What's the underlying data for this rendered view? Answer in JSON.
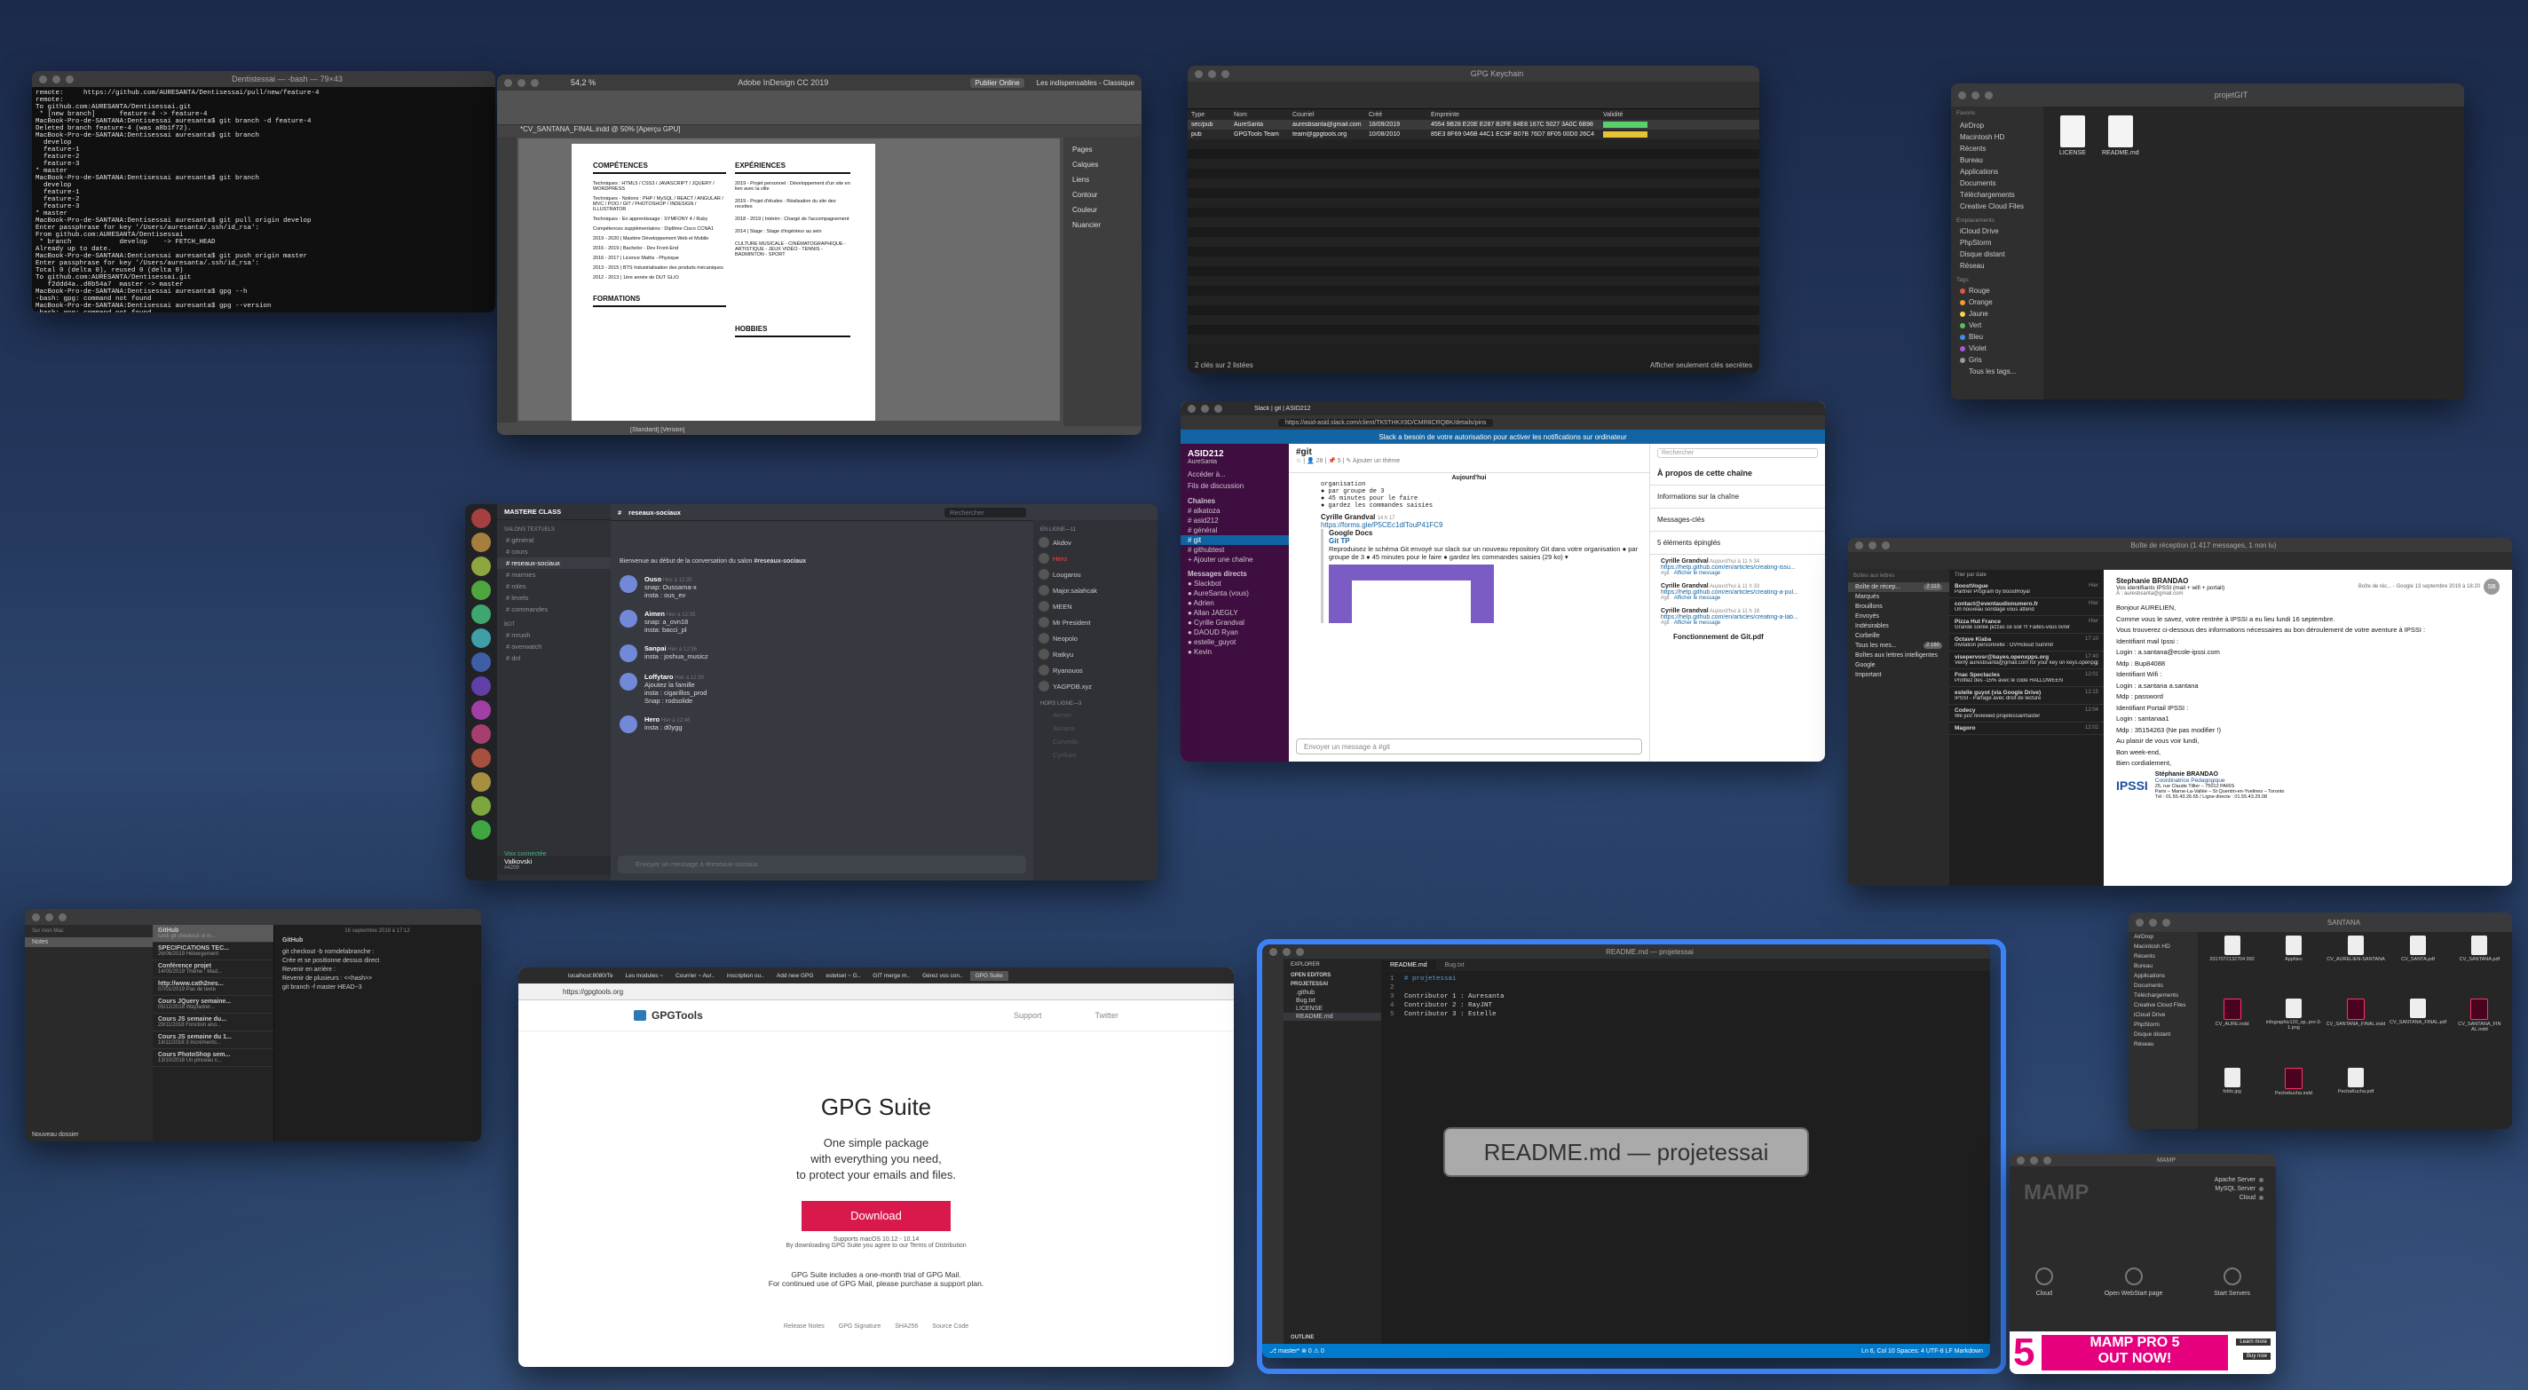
{
  "terminal": {
    "title": "Dentistessai — -bash — 79×43",
    "lines": [
      "remote:     https://github.com/AURESANTA/Dentisessai/pull/new/feature-4",
      "remote:",
      "To github.com:AURESANTA/Dentisessai.git",
      " * [new branch]      feature-4 -> feature-4",
      "MacBook-Pro-de-SANTANA:Dentisessai auresanta$ git branch -d feature-4",
      "Deleted branch feature-4 (was a8b1f72).",
      "MacBook-Pro-de-SANTANA:Dentisessai auresanta$ git branch",
      "  develop",
      "  feature-1",
      "  feature-2",
      "  feature-3",
      "* master",
      "MacBook-Pro-de-SANTANA:Dentisessai auresanta$ git branch",
      "  develop",
      "  feature-1",
      "  feature-2",
      "  feature-3",
      "* master",
      "MacBook-Pro-de-SANTANA:Dentisessai auresanta$ git pull origin develop",
      "Enter passphrase for key '/Users/auresanta/.ssh/id_rsa':",
      "From github.com:AURESANTA/Dentisessai",
      " * branch            develop    -> FETCH_HEAD",
      "Already up to date.",
      "MacBook-Pro-de-SANTANA:Dentisessai auresanta$ git push origin master",
      "Enter passphrase for key '/Users/auresanta/.ssh/id_rsa':",
      "Total 0 (delta 0), reused 0 (delta 0)",
      "To github.com:AURESANTA/Dentisessai.git",
      "   f2ddd4a..d8b54a7  master -> master",
      "MacBook-Pro-de-SANTANA:Dentisessai auresanta$ gpg --h",
      "-bash: gpg: command not found",
      "MacBook-Pro-de-SANTANA:Dentisessai auresanta$ gpg --version",
      "-bash: gpg: command not found",
      "MacBook-Pro-de-SANTANA:Dentisessai auresanta$ "
    ]
  },
  "indesign": {
    "title": "Adobe InDesign CC 2019",
    "publish_btn": "Publier Online",
    "workspace": "Les indispensables - Classique",
    "zoom": "54,2 %",
    "doc_tab": "*CV_SANTANA_FINAL.indd @ 50% [Aperçu GPU]",
    "status": "[Standard] [Version]",
    "panels": [
      "Pages",
      "Calques",
      "Liens",
      "Contour",
      "Couleur",
      "Nuancier"
    ],
    "resume": {
      "competences_h": "COMPÉTENCES",
      "experiences_h": "EXPÉRIENCES",
      "formations_h": "FORMATIONS",
      "hobbies_h": "HOBBIES",
      "left": [
        "Techniques : HTML5 / CSS3 / JAVASCRIPT / JQUERY / WORDPRESS",
        "Techniques - Notions : PHP / MySQL / REACT / ANGULAR / MVC / POO / GIT / PHOTOSHOP / INDESIGN / ILLUSTRATOR",
        "Techniques - En apprentissage : SYMFONY 4 / Ruby",
        "Compétences supplémentaires : Diplôme Cisco CCNA1",
        "2019 - 2020 | Mastère Développement Web et Mobile",
        "2016 - 2019 | Bachelor - Dev Front-End",
        "2016 - 2017 | Licence Maths - Physique",
        "2013 - 2015 | BTS Industrialisation des produits mécaniques",
        "2012 - 2013 | 1ère année de DUT GLIO"
      ],
      "right": [
        "2019 - Projet personnel : Développement d'un site en lien avec la ville",
        "2019 - Projet d'études : Réalisation du site des recettes",
        "2018 - 2019 | Intérim : Chargé de l'accompagnement",
        "2014 | Stage : Stage d'ingénieur au sein",
        "CULTURE MUSICALE - CINÉMATOGRAPHIQUE - ARTISTIQUE - JEUX VIDÉO - TENNIS - BADMINTON - SPORT"
      ]
    }
  },
  "gpg_keychain": {
    "title": "GPG Keychain",
    "headers": [
      "Type",
      "Nom",
      "Courriel",
      "Créé",
      "Empreinte",
      "Validité"
    ],
    "rows": [
      {
        "type": "sec/pub",
        "name": "AureSanta",
        "email": "auresbsanta@gmail.com",
        "created": "18/09/2019",
        "fpr": "4554 9B28 E20E E287 B2FE  84E8 167C 5027 3A0C 6B98",
        "validity": "#5ad06a"
      },
      {
        "type": "pub",
        "name": "GPGTools Team",
        "email": "team@gpgtools.org",
        "created": "10/08/2010",
        "fpr": "85E3 8F69 046B 44C1 EC9F  B07B 76D7 8F05 00D0 26C4",
        "validity": "#e6c332"
      }
    ],
    "status": "2 clés sur 2 listées",
    "show_secret": "Afficher seulement clés secrètes"
  },
  "finder_top": {
    "title": "projetGIT",
    "sections": {
      "favoris": "Favoris",
      "emplacements": "Emplacements",
      "tags": "Tags"
    },
    "favoris": [
      "AirDrop",
      "Macintosh HD",
      "Récents",
      "Bureau",
      "Applications",
      "Documents",
      "Téléchargements",
      "Creative Cloud Files"
    ],
    "emplacements": [
      "iCloud Drive",
      "PhpStorm",
      "Disque distant",
      "Réseau"
    ],
    "tags": [
      "Rouge",
      "Orange",
      "Jaune",
      "Vert",
      "Bleu",
      "Violet",
      "Gris",
      "Tous les tags..."
    ],
    "tag_colors": [
      "#e5534b",
      "#f09a37",
      "#f5d547",
      "#5ac05a",
      "#3f8de8",
      "#a45cd6",
      "#9a9a9a",
      "#00000000"
    ],
    "files": [
      "LICENSE",
      "README.md"
    ]
  },
  "slack": {
    "browser_tab": "Slack | git | ASID212",
    "url": "https://asid-asid.slack.com/client/TK5THKX9D/CMR8CRQBK/details/pins",
    "banner": "Slack a besoin de votre autorisation pour activer les notifications sur ordinateur",
    "banner_link": "activer les notifications sur ordinateur",
    "workspace": "ASID212",
    "user": "AureSanta",
    "nav": [
      "Accéder à...",
      "Fils de discussion"
    ],
    "channels_h": "Chaînes",
    "channels": [
      "alkatoza",
      "asid212",
      "général",
      "git",
      "githubtest"
    ],
    "add_channel": "+ Ajouter une chaîne",
    "dm_h": "Messages directs",
    "dms": [
      "Slackbot",
      "AureSanta (vous)",
      "Adrien",
      "Allan JAEGLY",
      "Cyrille Grandval",
      "DAOUD Ryan",
      "estelle_guyot",
      "Kevin"
    ],
    "channel": "#git",
    "channel_meta": "☆ | 👤 28 | 📌 5 | ✎ Ajouter un thème",
    "search_ph": "Rechercher",
    "today": "Aujourd'hui",
    "msg_pre": [
      "organisation",
      "● par groupe de 3",
      "● 45 minutes pour le faire",
      "● gardez les commandes saisies"
    ],
    "author": "Cyrille Grandval",
    "time": "14 h 17",
    "link": "https://forms.gle/P5CEc1dITouP41FC9",
    "gdoc": "Google Docs",
    "gtitle": "Git TP",
    "body": "Reproduisez le schéma Git envoyé sur slack sur un nouveau repository Git dans votre organisation ● par groupe de 3 ● 45 minutes pour le faire ● gardez les commandes saisies (29 ko) ▾",
    "composer": "Envoyer un message à #git",
    "details_title": "À propos de cette chaîne",
    "details": [
      "Informations sur la chaîne",
      "Messages-clés",
      "5 éléments épinglés"
    ],
    "pins": [
      {
        "who": "Cyrille Grandval",
        "when": "Aujourd'hui à 11 h 34",
        "link": "https://help.github.com/en/articles/creating-issu..."
      },
      {
        "who": "Cyrille Grandval",
        "when": "Aujourd'hui à 11 h 33",
        "link": "https://help.github.com/en/articles/creating-a-pul..."
      },
      {
        "who": "Cyrille Grandval",
        "when": "Aujourd'hui à 11 h 18",
        "link": "https://help.github.com/en/articles/creating-a-lab..."
      }
    ],
    "pin_channel": "#git",
    "pin_action": "Afficher le message",
    "pdf": "Fonctionnement de Git.pdf"
  },
  "discord": {
    "server": "MASTERE CLASS",
    "channel": "reseaux-sociaux",
    "search_ph": "Rechercher",
    "category1": "SALONS TEXTUELS",
    "channels": [
      "général",
      "cours",
      "reseaux-sociaux",
      "marmes",
      "roles",
      "levels",
      "commandes"
    ],
    "category2": "BOT",
    "channels2": [
      "mruoh",
      "overwatch",
      "dnl"
    ],
    "welcome": "Bienvenue au début de la conversation du salon ",
    "welcome_bold": "#reseaux-sociaux",
    "messages": [
      {
        "name": "Ouso",
        "time": "Hier à 12:35",
        "lines": [
          "snap: Oussama-x",
          "insta : ous_ev"
        ]
      },
      {
        "name": "Aimen",
        "time": "Hier à 12:35",
        "lines": [
          "snap: a_ovn18",
          "insta: bacci_pl"
        ]
      },
      {
        "name": "Sanpai",
        "time": "Hier à 12:36",
        "lines": [
          "insta : joshua_musicz"
        ]
      },
      {
        "name": "Loffytaro",
        "time": "Hier à 12:39",
        "lines": [
          "Ajoutez la famille",
          "insta : cigarillos_prod",
          "Snap : rodsolide"
        ]
      },
      {
        "name": "Hero",
        "time": "Hier à 12:46",
        "lines": [
          "insta : d0ygg"
        ]
      }
    ],
    "composer": "Envoyer un message à #reseaux-sociaux",
    "members_h": "EN LIGNE—11",
    "members": [
      "Akdov",
      "Hero",
      "Lougarou",
      "Major.salahcak",
      "MEEN",
      "Mr President",
      "Neopolo",
      "Ratkyu",
      "Ryanouos",
      "YAGPDB.xyz"
    ],
    "offline_h": "HORS LIGNE—3",
    "offline": [
      "Aiman",
      "Aksana",
      "Curvedo",
      "Cyriluxe"
    ],
    "connected": "Voix connectée",
    "user": "Valkovski",
    "user_tag": "#4209"
  },
  "mail": {
    "title": "Boîte de réception (1 417 messages, 1 non lu)",
    "filter": "Trier par date",
    "mailboxes_h": "Boîtes aux lettres",
    "mailboxes": [
      "Boîte de récep...",
      "Marqués",
      "Brouillons",
      "Envoyés",
      "Indésirables",
      "Corbeille",
      "Tous les mes...",
      "Boîtes aux lettres intelligentes",
      "Google",
      "Important"
    ],
    "mailbox_counts": [
      "2 113",
      "",
      "",
      "",
      "",
      "",
      "2 160",
      "",
      "",
      ""
    ],
    "list": [
      {
        "from": "BoostVogue",
        "subj": "Partner Program by BoostRoyal",
        "when": "Hier"
      },
      {
        "from": "contact@eventaudionumero.fr",
        "subj": "Un nouveau sondage vous attend",
        "when": "Hier"
      },
      {
        "from": "Pizza Hut France",
        "subj": "Grande soirée pizzas ce soir !!! Faites-vous livrer",
        "when": "Hier"
      },
      {
        "from": "Octave Klaba",
        "subj": "Invitation personnelle : OVHcloud Summit",
        "when": "17:10"
      },
      {
        "from": "visepervosr@bayes.openxpps.org",
        "subj": "Verify auresbsanta@gmail.com for your key on keys.openpgp.org",
        "when": "17:40"
      },
      {
        "from": "Fnac Spectacles",
        "subj": "Profitez des -15% avec le code HALLOWEEN",
        "when": "12:01"
      },
      {
        "from": "estelle guyot (via Google Drive)",
        "subj": "IPSSI - Partage avec droit de lecture",
        "when": "12:15"
      },
      {
        "from": "Codecy",
        "subj": "We just reviewed projetessai/master",
        "when": "12:04"
      },
      {
        "from": "Magoro",
        "subj": "",
        "when": "12:02"
      }
    ],
    "from": "Stephanie BRANDAO",
    "to": "Vos identifiants IPSSI (mail + wifi + portail)",
    "to2": "À : auresbsanta@gmail.com",
    "date": "Boîte de réc... - Google   13 septembre 2019 à 18:20",
    "avatar": "SB",
    "body": [
      "Bonjour AURELIEN,",
      "Comme vous le savez, votre rentrée à IPSSI a eu lieu lundi 16 septembre.",
      "Vous trouverez ci-dessous des informations nécessaires au bon déroulement de votre aventure à IPSSI :",
      "Identifiant mail Ipssi :",
      "Login : a.santana@ecole-ipssi.com",
      "Mdp : Bup84088",
      "Identifiant Wifi :",
      "Login : a.santana a.santana",
      "Mdp : password",
      "Identifiant Portail IPSSI :",
      "Login : santanaa1",
      "Mdp : 35154263 (Ne pas modifier !)",
      "Au plaisir de vous voir lundi,",
      "Bon week-end,",
      "Bien cordialement,"
    ],
    "sig_name": "Stéphanie BRANDAO",
    "sig_role": "Coordinatrice Pédagogique",
    "sig_logo": "IPSSI",
    "sig_addr": "25, rue Claude Tillier – 75012 PARIS\nParis – Marne-La-Vallée – St Quentin-en-Yvelines – Toronto\nTél : 01.55.43.26.65 / Ligne directe : 01.55.43.29.08"
  },
  "notes": {
    "title": "Notes",
    "folders_h": "Sur mon Mac",
    "folders": [
      "Notes"
    ],
    "new_folder": "Nouveau dossier",
    "date": "16 septembre 2019 à 17:12",
    "list": [
      {
        "t": "GitHub",
        "d": "lundi  git checkout -b m..."
      },
      {
        "t": "SPECIFICATIONS TEC...",
        "d": "26/06/2019  Hébergement"
      },
      {
        "t": "Conférence projet",
        "d": "14/05/2019  Thème : Mad..."
      },
      {
        "t": "http://www.cath2nes...",
        "d": "07/01/2019  Pas de texte"
      },
      {
        "t": "Cours JQuery semaine...",
        "d": "05/12/2018  Wayfadrer..."
      },
      {
        "t": "Cours JS semaine du...",
        "d": "29/11/2018  Fonction ano..."
      },
      {
        "t": "Cours JS semaine du 1...",
        "d": "18/11/2018  3 Incréments..."
      },
      {
        "t": "Cours PhotoShop sem...",
        "d": "13/10/2018  Un pinceau c..."
      }
    ],
    "content": [
      "GitHub",
      "git checkout -b nomdelabranche :",
      "Crée et se positionne dessus direct",
      "Revenir en arrière :",
      "Revenir de plusieurs : <<hash>>",
      "git branch -f master HEAD~3"
    ]
  },
  "gpgsuite": {
    "tabs": [
      "localhost:8080/Te",
      "Les modules ~",
      "Courrier ~ Aur..",
      "inscription ou..",
      "Add new GPG",
      "estetset ~ G..",
      "GIT merge m..",
      "Gérez vos con..",
      "GPG Suite"
    ],
    "url": "https://gpgtools.org",
    "brand": "GPGTools",
    "nav": [
      "Support",
      "Twitter"
    ],
    "headline": "GPG Suite",
    "sub": "One simple package\nwith everything you need,\nto protect your emails and files.",
    "download": "Download",
    "supports": "Supports macOS 10.12 - 10.14",
    "agree": "By downloading GPG Suite you agree to our Terms of Distribution",
    "trial": "GPG Suite includes a one-month trial of GPG Mail.\nFor continued use of GPG Mail, please purchase a support plan.",
    "footer": [
      "Release Notes",
      "GPG Signature",
      "SHA256",
      "Source Code"
    ],
    "accent": "#d9194b"
  },
  "vscode": {
    "title": "README.md — projetessai",
    "explorer": "EXPLORER",
    "open_editors": "OPEN EDITORS",
    "project": "PROJETESSAI",
    "tree": [
      ".github",
      "Bug.txt",
      "LICENSE",
      "README.md"
    ],
    "tabs": [
      "README.md",
      "Bug.txt"
    ],
    "code": [
      "# projetessai",
      "",
      "Contributor 1 : Auresanta",
      "Contributor 2 : RayJNT",
      "Contributor 3 : Estelle"
    ],
    "outline": "OUTLINE",
    "status_left": "⎇ master*  ⊗ 0 ⚠ 0",
    "status_right": "Ln 6, Col 10   Spaces: 4   UTF-8   LF   Markdown",
    "pill": "README.md — projetessai"
  },
  "finder_bottom": {
    "title": "SANTANA",
    "favoris": [
      "AirDrop",
      "Macintosh HD",
      "Récents",
      "Bureau",
      "Applications",
      "Documents",
      "Téléchargements",
      "Creative Cloud Files"
    ],
    "emplacements": [
      "iCloud Drive",
      "PhpStorm",
      "Disque distant",
      "Réseau"
    ],
    "files": [
      "2017072132704 992",
      "AppNev",
      "CV_AURELIEN-SANTANA",
      "CV_SANTA.pdf",
      "CV_SANTANA.pdf",
      "CV_AURE.indd",
      "infographic120_sp..pro-3-1.png",
      "CV_SANTANA_FINAL.indd",
      "CV_SANTANA_FINAL.pdf",
      "CV_SANTANA_FIN AL.indd",
      "fsfds.jpg",
      "Pechekucha.indd",
      "PechaKucha.pdf"
    ]
  },
  "mamp": {
    "title": "MAMP",
    "status": [
      "Apache Server",
      "MySQL Server",
      "Cloud"
    ],
    "logo": "MAMP",
    "actions": [
      "Cloud",
      "Open WebStart page",
      "Start Servers"
    ],
    "ad": "MAMP PRO 5",
    "ad2": "OUT NOW!",
    "ad_btn1": "Learn more",
    "ad_btn2": "Buy now",
    "ad_num": "5"
  }
}
